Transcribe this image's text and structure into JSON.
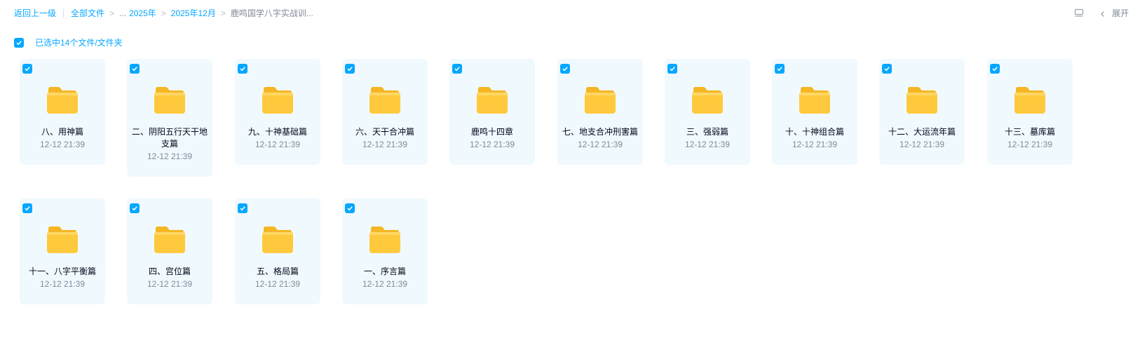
{
  "breadcrumb": {
    "back": "返回上一级",
    "all_files": "全部文件",
    "ellipsis": "...",
    "items": [
      "2025年",
      "2025年12月"
    ],
    "current": "鹿鸣国学八字实战训..."
  },
  "toolbar": {
    "layout_icon": "list-layout-icon",
    "expand_label": "展开"
  },
  "selection": {
    "text": "已选中14个文件/文件夹",
    "checked": true
  },
  "colors": {
    "accent": "#06a7ff",
    "card_bg": "#f0f9fd",
    "folder": "#ffc93d"
  },
  "folders": [
    {
      "name": "八、用神篇",
      "time": "12-12 21:39"
    },
    {
      "name": "二、阴阳五行天干地支篇",
      "time": "12-12 21:39"
    },
    {
      "name": "九、十神基础篇",
      "time": "12-12 21:39"
    },
    {
      "name": "六、天干合冲篇",
      "time": "12-12 21:39"
    },
    {
      "name": "鹿鸣十四章",
      "time": "12-12 21:39"
    },
    {
      "name": "七、地支合冲刑害篇",
      "time": "12-12 21:39"
    },
    {
      "name": "三、强弱篇",
      "time": "12-12 21:39"
    },
    {
      "name": "十、十神组合篇",
      "time": "12-12 21:39"
    },
    {
      "name": "十二、大运流年篇",
      "time": "12-12 21:39"
    },
    {
      "name": "十三、墓库篇",
      "time": "12-12 21:39"
    },
    {
      "name": "十一、八字平衡篇",
      "time": "12-12 21:39"
    },
    {
      "name": "四、宫位篇",
      "time": "12-12 21:39"
    },
    {
      "name": "五、格局篇",
      "time": "12-12 21:39"
    },
    {
      "name": "一、序言篇",
      "time": "12-12 21:39"
    }
  ]
}
